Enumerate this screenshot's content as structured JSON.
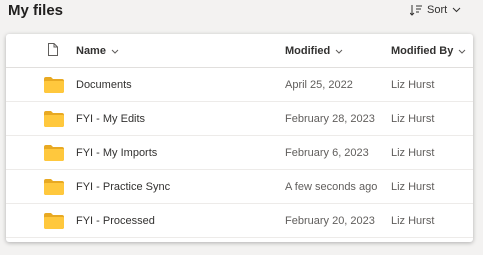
{
  "header": {
    "title": "My files",
    "sort_label": "Sort"
  },
  "columns": {
    "name": "Name",
    "modified": "Modified",
    "modified_by": "Modified By"
  },
  "files": [
    {
      "name": "Documents",
      "modified": "April 25, 2022",
      "modified_by": "Liz Hurst"
    },
    {
      "name": "FYI - My Edits",
      "modified": "February 28, 2023",
      "modified_by": "Liz Hurst"
    },
    {
      "name": "FYI - My Imports",
      "modified": "February 6, 2023",
      "modified_by": "Liz Hurst"
    },
    {
      "name": "FYI - Practice Sync",
      "modified": "A few seconds ago",
      "modified_by": "Liz Hurst"
    },
    {
      "name": "FYI - Processed",
      "modified": "February 20, 2023",
      "modified_by": "Liz Hurst"
    }
  ],
  "icons": {
    "sort": "sort-icon",
    "file_type": "document-icon",
    "folder": "folder-icon",
    "chevron": "chevron-down-icon"
  },
  "colors": {
    "folder_back": "#e8a922",
    "folder_front": "#ffc83d",
    "text_primary": "#323130",
    "text_secondary": "#605e5c"
  }
}
